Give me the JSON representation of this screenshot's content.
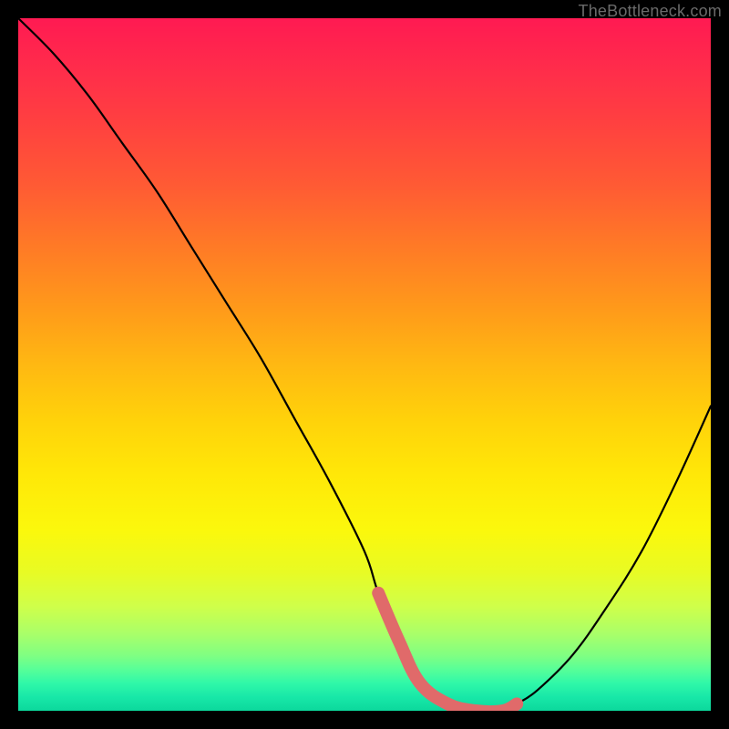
{
  "watermark": "TheBottleneck.com",
  "colors": {
    "background": "#000000",
    "curve": "#000000",
    "highlight": "#e06a6a"
  },
  "chart_data": {
    "type": "line",
    "title": "",
    "xlabel": "",
    "ylabel": "",
    "xlim": [
      0,
      100
    ],
    "ylim": [
      0,
      100
    ],
    "series": [
      {
        "name": "bottleneck-curve",
        "x": [
          0,
          5,
          10,
          15,
          20,
          25,
          30,
          35,
          40,
          45,
          50,
          52,
          55,
          58,
          62,
          66,
          70,
          72,
          75,
          80,
          85,
          90,
          95,
          100
        ],
        "values": [
          100,
          95,
          89,
          82,
          75,
          67,
          59,
          51,
          42,
          33,
          23,
          17,
          10,
          4,
          1,
          0,
          0,
          1,
          3,
          8,
          15,
          23,
          33,
          44
        ]
      },
      {
        "name": "highlight-range",
        "x": [
          52,
          55,
          58,
          62,
          66,
          70,
          72
        ],
        "values": [
          17,
          10,
          4,
          1,
          0,
          0,
          1
        ]
      }
    ],
    "annotations": []
  }
}
